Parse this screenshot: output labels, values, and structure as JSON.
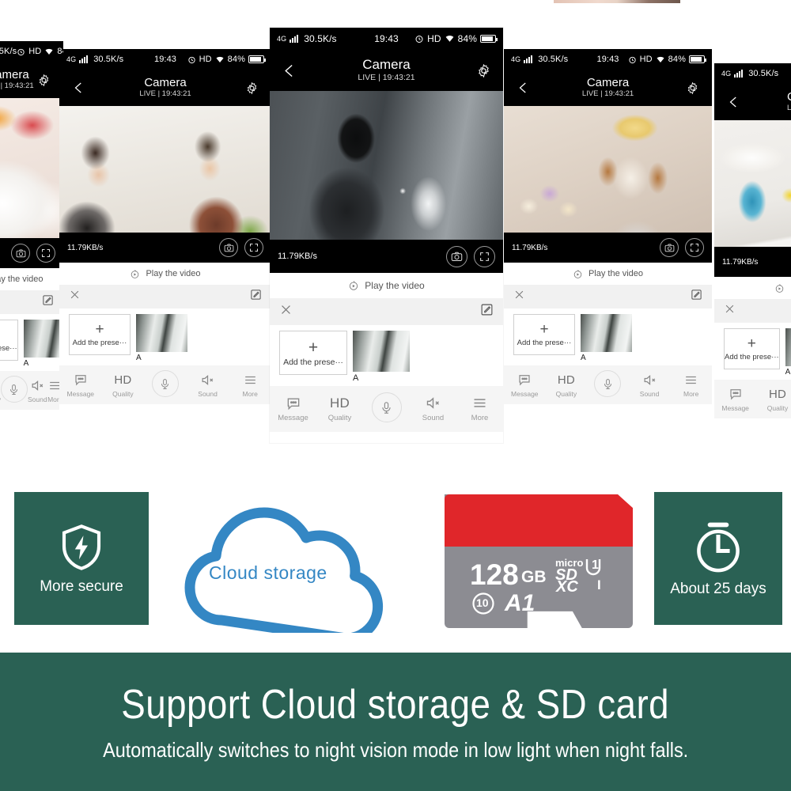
{
  "statusbar": {
    "network": "4G",
    "speed": "30.5K/s",
    "time": "19:43",
    "hd": "HD",
    "battery": "84%"
  },
  "navbar": {
    "title": "Camera",
    "subtitle": "LIVE | 19:43:21",
    "back_icon": "arrow-left-icon",
    "settings_icon": "gear-icon"
  },
  "video": {
    "bitrate": "11.79KB/s",
    "snapshot_icon": "camera-icon",
    "fullscreen_icon": "expand-icon"
  },
  "play_row": {
    "label": "Play the video",
    "icon": "replay-icon"
  },
  "preset_bar": {
    "close_icon": "close-icon",
    "edit_icon": "edit-icon"
  },
  "presets": {
    "add_label": "Add the prese···",
    "add_plus": "+",
    "item_name": "A"
  },
  "toolbar": [
    {
      "label": "Message",
      "icon": "message-icon"
    },
    {
      "label": "Quality",
      "icon": "hd-icon",
      "value": "HD"
    },
    {
      "label": "",
      "icon": "mic-icon"
    },
    {
      "label": "Sound",
      "icon": "mute-icon"
    },
    {
      "label": "More",
      "icon": "menu-icon"
    }
  ],
  "phones": [
    {
      "scene": "bedroom-pillows"
    },
    {
      "scene": "elderly-couple-dining"
    },
    {
      "scene": "night-vision-burglar"
    },
    {
      "scene": "dog-with-bow"
    },
    {
      "scene": "blue-lamp-flowers"
    }
  ],
  "features": {
    "secure": {
      "label": "More secure",
      "icon": "shield-bolt-icon"
    },
    "cloud": {
      "label": "Cloud storage",
      "icon": "cloud-icon"
    },
    "sdcard": {
      "capacity": "128",
      "unit": "GB",
      "micro": "micro",
      "sd": "SD",
      "xc": "XC",
      "u1": "1",
      "speed_class": "I",
      "class10": "10",
      "a1": "A1"
    },
    "duration": {
      "label": "About 25 days",
      "icon": "stopwatch-icon"
    }
  },
  "banner": {
    "title": "Support Cloud storage & SD card",
    "subtitle": "Automatically switches to night vision mode in low light when night falls."
  },
  "colors": {
    "green": "#2a6154",
    "cloud_blue": "#3487c4",
    "sd_red": "#e0262a",
    "sd_gray": "#8c8c92"
  }
}
